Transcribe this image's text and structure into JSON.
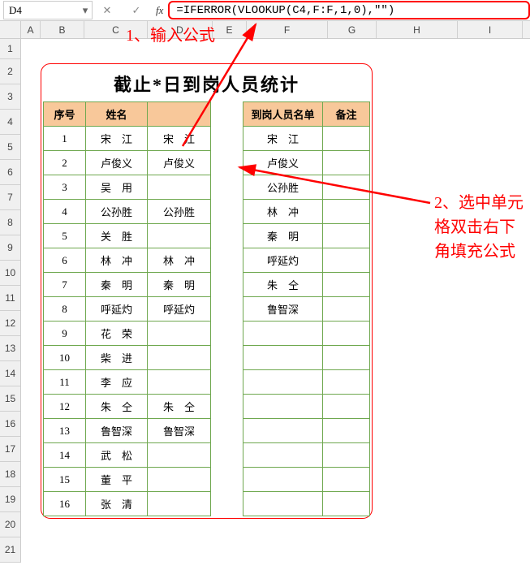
{
  "namebox": "D4",
  "formula": "=IFERROR(VLOOKUP(C4,F:F,1,0),\"\")",
  "col_labels": [
    "A",
    "B",
    "C",
    "D",
    "E",
    "F",
    "G",
    "H",
    "I"
  ],
  "row_labels": [
    "1",
    "2",
    "3",
    "4",
    "5",
    "6",
    "7",
    "8",
    "9",
    "10",
    "11",
    "12",
    "13",
    "14",
    "15",
    "16",
    "17",
    "18",
    "19",
    "20",
    "21"
  ],
  "title": "截止*日到岗人员统计",
  "headers": {
    "seq": "序号",
    "name": "姓名",
    "check": "",
    "sep": "",
    "roster": "到岗人员名单",
    "note": "备注"
  },
  "rows": [
    {
      "seq": "1",
      "name": "宋　江",
      "check": "宋　江",
      "roster": "宋　江",
      "note": ""
    },
    {
      "seq": "2",
      "name": "卢俊义",
      "check": "卢俊义",
      "roster": "卢俊义",
      "note": ""
    },
    {
      "seq": "3",
      "name": "吴　用",
      "check": "",
      "roster": "公孙胜",
      "note": ""
    },
    {
      "seq": "4",
      "name": "公孙胜",
      "check": "公孙胜",
      "roster": "林　冲",
      "note": ""
    },
    {
      "seq": "5",
      "name": "关　胜",
      "check": "",
      "roster": "秦　明",
      "note": ""
    },
    {
      "seq": "6",
      "name": "林　冲",
      "check": "林　冲",
      "roster": "呼延灼",
      "note": ""
    },
    {
      "seq": "7",
      "name": "秦　明",
      "check": "秦　明",
      "roster": "朱　仝",
      "note": ""
    },
    {
      "seq": "8",
      "name": "呼延灼",
      "check": "呼延灼",
      "roster": "鲁智深",
      "note": ""
    },
    {
      "seq": "9",
      "name": "花　荣",
      "check": "",
      "roster": "",
      "note": ""
    },
    {
      "seq": "10",
      "name": "柴　进",
      "check": "",
      "roster": "",
      "note": ""
    },
    {
      "seq": "11",
      "name": "李　应",
      "check": "",
      "roster": "",
      "note": ""
    },
    {
      "seq": "12",
      "name": "朱　仝",
      "check": "朱　仝",
      "roster": "",
      "note": ""
    },
    {
      "seq": "13",
      "name": "鲁智深",
      "check": "鲁智深",
      "roster": "",
      "note": ""
    },
    {
      "seq": "14",
      "name": "武　松",
      "check": "",
      "roster": "",
      "note": ""
    },
    {
      "seq": "15",
      "name": "董　平",
      "check": "",
      "roster": "",
      "note": ""
    },
    {
      "seq": "16",
      "name": "张　清",
      "check": "",
      "roster": "",
      "note": ""
    }
  ],
  "anno1": "1、输入公式",
  "anno2": "2、选中单元格双击右下角填充公式"
}
